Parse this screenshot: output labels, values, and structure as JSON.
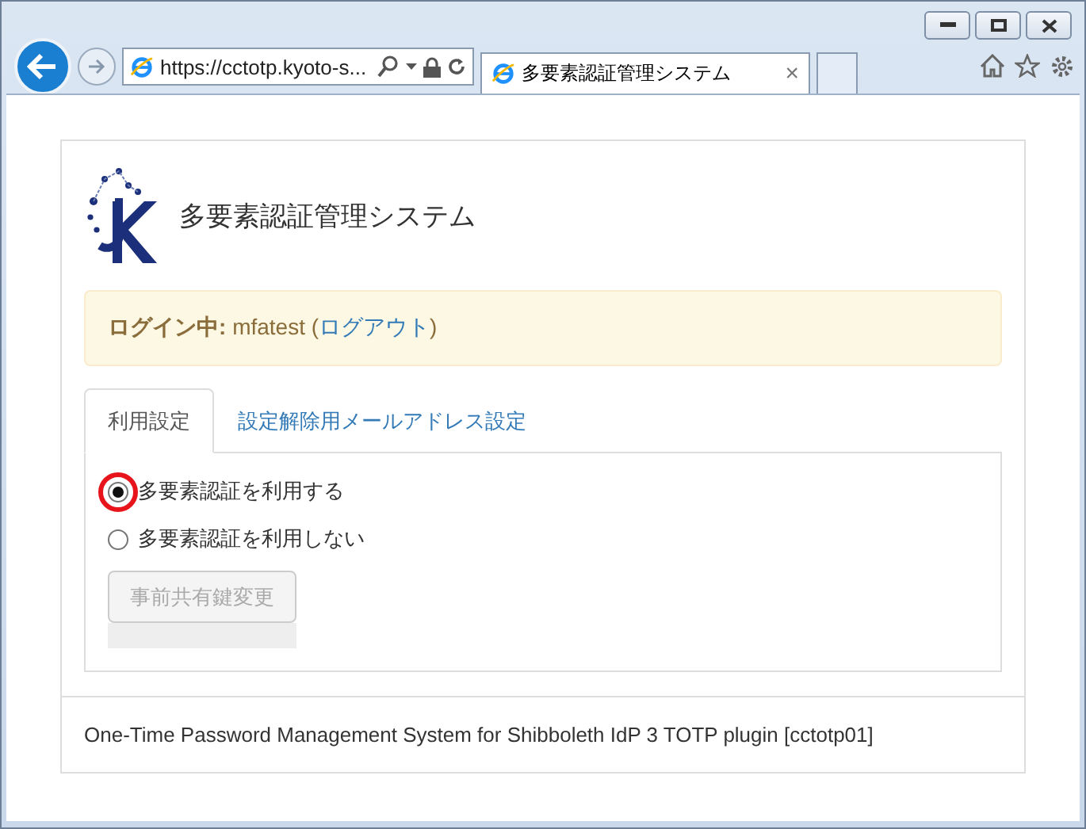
{
  "browser": {
    "address": "https://cctotp.kyoto-s...",
    "tab_title": "多要素認証管理システム",
    "tab_close": "×"
  },
  "header": {
    "title": "多要素認証管理システム"
  },
  "login_alert": {
    "label": "ログイン中:",
    "user": "mfatest",
    "logout_link": "ログアウト",
    "open_paren": "(",
    "close_paren": ")"
  },
  "tabs": [
    {
      "label": "利用設定",
      "selected": true
    },
    {
      "label": "設定解除用メールアドレス設定",
      "selected": false
    }
  ],
  "options": [
    {
      "label": "多要素認証を利用する",
      "selected": true,
      "highlighted": true
    },
    {
      "label": "多要素認証を利用しない",
      "selected": false,
      "highlighted": false
    }
  ],
  "change_key_button": {
    "label": "事前共有鍵変更",
    "disabled": true
  },
  "footer": "One-Time Password Management System for Shibboleth IdP 3 TOTP plugin [cctotp01]"
}
